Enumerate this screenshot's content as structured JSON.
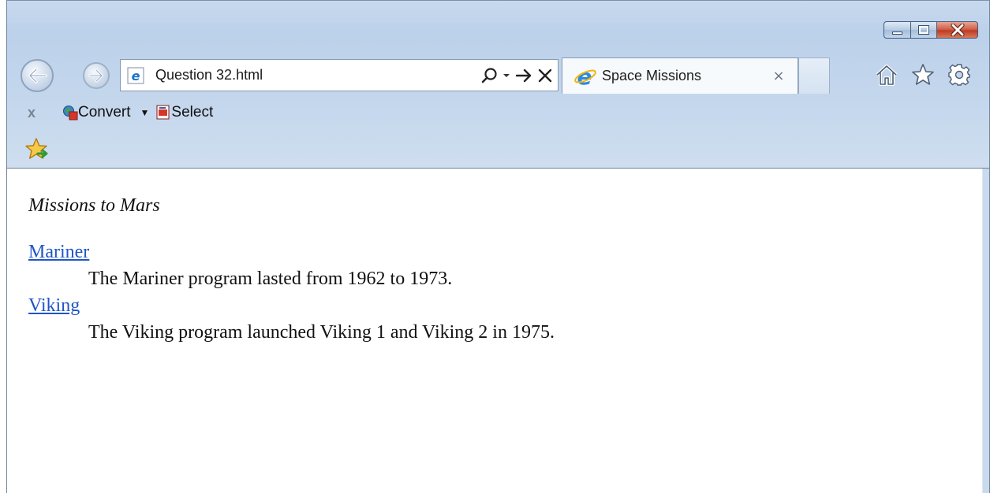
{
  "browser": {
    "address_text": "Question 32.html",
    "tab_title": "Space Missions",
    "tab_close": "×",
    "command_bar": {
      "close_label": "x",
      "convert_label": "Convert",
      "convert_dropdown": "▼",
      "select_label": "Select"
    },
    "icons": [
      "back-arrow-icon",
      "forward-arrow-icon",
      "ie-favicon-icon",
      "search-icon",
      "refresh-arrow-icon",
      "stop-icon",
      "home-icon",
      "favorites-star-icon",
      "gear-icon",
      "add-favorites-icon"
    ]
  },
  "page": {
    "heading": "Missions to Mars",
    "entries": [
      {
        "term": "Mariner",
        "description": "The Mariner program lasted from 1962 to 1973."
      },
      {
        "term": "Viking",
        "description": "The Viking program launched Viking 1 and Viking 2 in 1975."
      }
    ]
  }
}
